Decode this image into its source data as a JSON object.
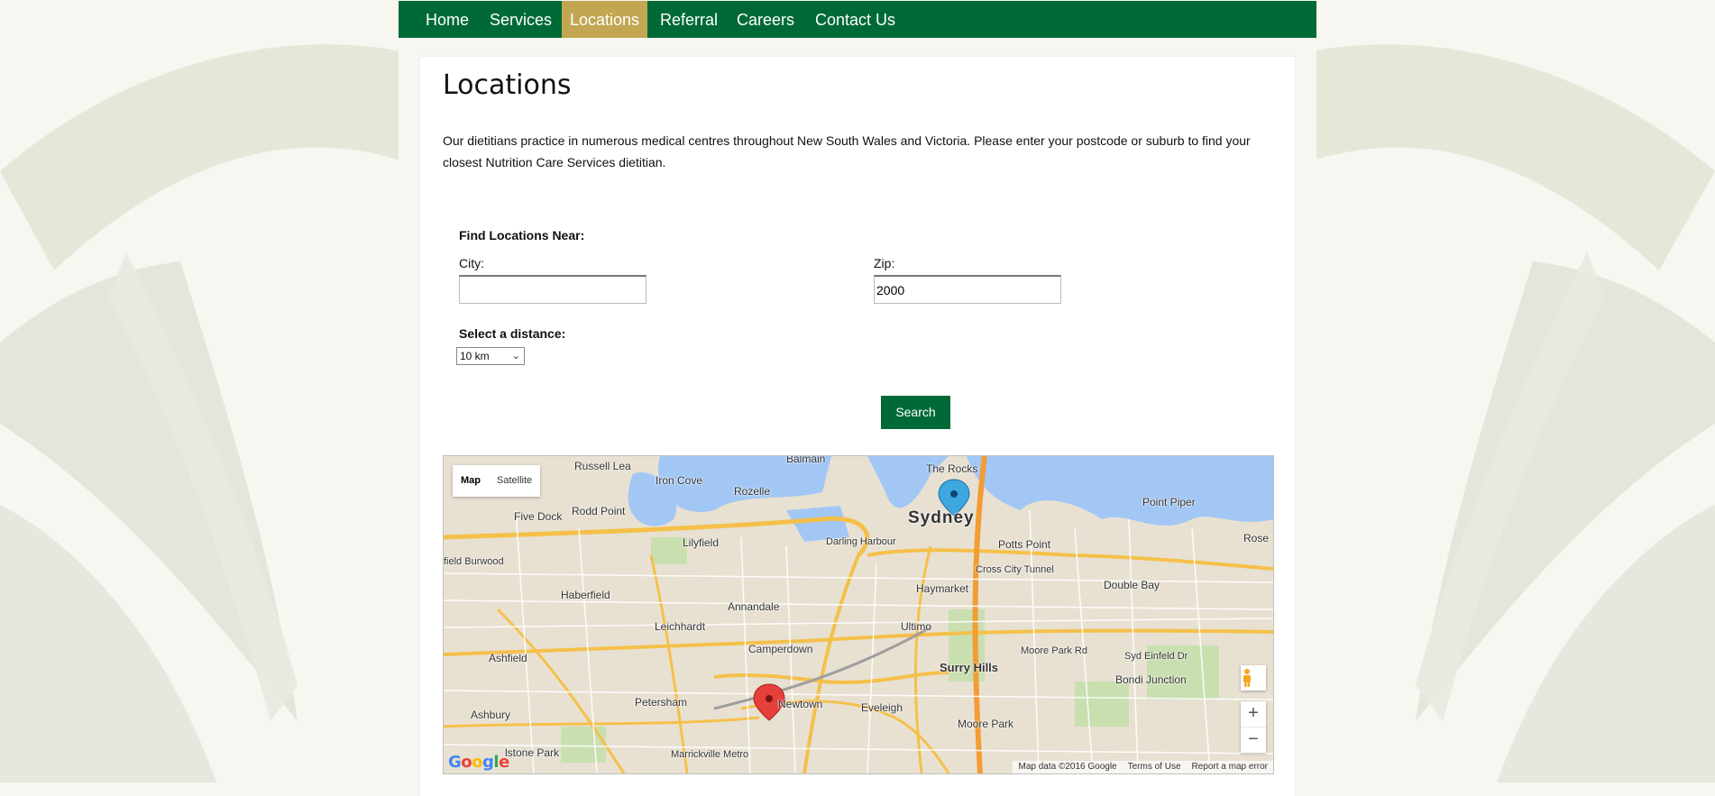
{
  "nav": {
    "items": [
      {
        "label": "Home"
      },
      {
        "label": "Services"
      },
      {
        "label": "Locations"
      },
      {
        "label": "Referral"
      },
      {
        "label": "Careers"
      },
      {
        "label": "Contact Us"
      }
    ],
    "active": "Locations"
  },
  "page": {
    "title": "Locations",
    "intro": "Our dietitians practice in numerous medical centres throughout New South Wales and Victoria. Please enter your postcode or suburb to find your closest Nutrition Care Services dietitian."
  },
  "form": {
    "heading": "Find Locations Near:",
    "city_label": "City:",
    "city_value": "",
    "zip_label": "Zip:",
    "zip_value": "2000",
    "distance_label": "Select a distance:",
    "distance_value": "10 km",
    "search_label": "Search"
  },
  "map": {
    "type_map": "Map",
    "type_satellite": "Satellite",
    "labels": {
      "russell_lea": "Russell Lea",
      "iron_cove": "Iron Cove",
      "balmain": "Balmain",
      "rozelle": "Rozelle",
      "the_rocks": "The Rocks",
      "sydney": "Sydney",
      "point_piper": "Point Piper",
      "rose_bay": "Rose",
      "five_dock": "Five Dock",
      "rodd_point": "Rodd Point",
      "lilyfield": "Lilyfield",
      "darling_harbour": "Darling Harbour",
      "potts_point": "Potts Point",
      "burwood": "field Burwood",
      "haberfield": "Haberfield",
      "annandale": "Annandale",
      "haymarket": "Haymarket",
      "double_bay": "Double Bay",
      "leichhardt": "Leichhardt",
      "ultimo": "Ultimo",
      "camperdown": "Camperdown",
      "ashfield": "Ashfield",
      "surry_hills": "Surry Hills",
      "bondi_junction": "Bondi Junction",
      "petersham": "Petersham",
      "newtown": "Newtown",
      "eveleigh": "Eveleigh",
      "ashbury": "Ashbury",
      "moore_park": "Moore Park",
      "stone_park": "lstone Park",
      "marrickville_metro": "Marrickville Metro",
      "cross_city_tunnel": "Cross City Tunnel",
      "moore_park_rd": "Moore Park Rd",
      "syd_einfeld": "Syd Einfeld Dr"
    },
    "attribution": "Map data ©2016 Google",
    "terms": "Terms of Use",
    "report": "Report a map error",
    "google": "Google",
    "zoom_in": "+",
    "zoom_out": "−"
  },
  "colors": {
    "nav_bg": "#006a37",
    "nav_active": "#c2a652",
    "button": "#006a37"
  }
}
